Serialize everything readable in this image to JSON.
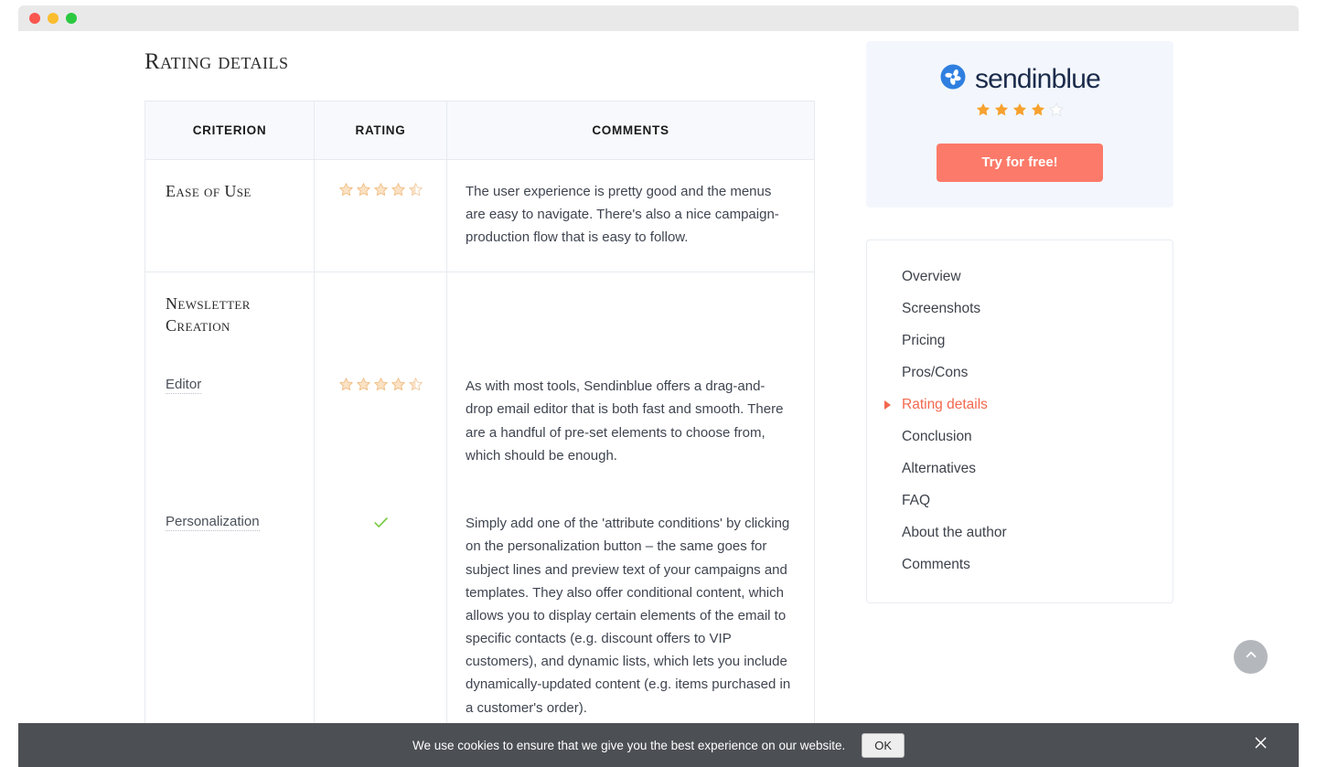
{
  "window": {
    "traffic_lights": [
      "close",
      "minimize",
      "zoom"
    ]
  },
  "main": {
    "page_title": "Rating details",
    "table": {
      "headers": [
        "CRITERION",
        "RATING",
        "COMMENTS"
      ],
      "rows": [
        {
          "criterion": "Ease of Use",
          "rating_type": "stars",
          "rating_value": 4.5,
          "rating_max": 5,
          "comment": "The user experience is pretty good and the menus are easy to navigate. There's also a nice campaign-production flow that is easy to follow."
        },
        {
          "criterion": "Newsletter Creation",
          "rating_type": "none",
          "comment": "",
          "subrows": [
            {
              "label": "Editor",
              "label_has_dotted_underline": true,
              "rating_type": "stars",
              "rating_value": 4.5,
              "rating_max": 5,
              "comment": "As with most tools, Sendinblue offers a drag-and-drop email editor that is both fast and smooth. There are a handful of pre-set elements to choose from, which should be enough."
            },
            {
              "label": "Personalization",
              "label_has_dotted_underline": true,
              "rating_type": "check",
              "comment": "Simply add one of the 'attribute conditions' by clicking on the personalization button – the same goes for subject lines and preview text of your campaigns and templates. They also offer conditional content, which allows you to display certain elements of the email to specific contacts (e.g. discount offers to VIP customers), and dynamic lists, which lets you include dynamically-updated content (e.g. items purchased in a customer's order)."
            }
          ]
        }
      ]
    }
  },
  "right_rail": {
    "promo": {
      "brand_name": "sendinblue",
      "logo_icon": "sendinblue-pinwheel-icon",
      "rating_value": 4,
      "rating_max": 5,
      "cta_label": "Try for free!"
    },
    "toc": {
      "items": [
        {
          "label": "Overview",
          "active": false
        },
        {
          "label": "Screenshots",
          "active": false
        },
        {
          "label": "Pricing",
          "active": false
        },
        {
          "label": "Pros/Cons",
          "active": false
        },
        {
          "label": "Rating details",
          "active": true
        },
        {
          "label": "Conclusion",
          "active": false
        },
        {
          "label": "Alternatives",
          "active": false
        },
        {
          "label": "FAQ",
          "active": false
        },
        {
          "label": "About the author",
          "active": false
        },
        {
          "label": "Comments",
          "active": false
        }
      ]
    }
  },
  "scroll_top": {
    "icon": "chevron-up-icon"
  },
  "cookie_banner": {
    "text": "We use cookies to ensure that we give you the best experience on our website.",
    "ok_label": "OK",
    "close_icon": "close-icon"
  },
  "colors": {
    "accent_coral": "#f4674d",
    "cta_coral": "#fc7a69",
    "star_filled": "#f7a12e",
    "star_faded": "#f0c79a",
    "check_green": "#7ac943",
    "table_header_bg": "#f7f9fc",
    "promo_card_bg": "#f3f7fd",
    "banner_bg": "#4c4f54",
    "brand_navy": "#1b2b4b",
    "logo_blue": "#2f7fe0"
  }
}
